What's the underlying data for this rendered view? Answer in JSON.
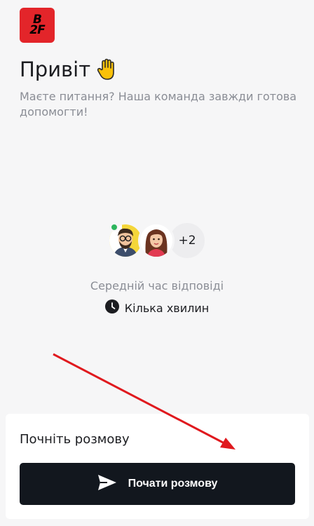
{
  "brand": {
    "logo_line1": "B",
    "logo_line2": "2F",
    "accent": "#e3252a"
  },
  "header": {
    "greeting": "Привіт",
    "greeting_icon": "raised-hand-icon",
    "subtitle": "Маєте питання? Наша команда завжди готова допомогти!"
  },
  "team": {
    "online_status_color": "#2db55d",
    "extra_count": "+2"
  },
  "response": {
    "label": "Середній час відповіді",
    "value": "Кілька хвилин",
    "icon": "clock-icon"
  },
  "conversation": {
    "title": "Почніть розмову",
    "button_label": "Почати розмову",
    "button_icon": "send-icon",
    "button_color": "#12171e"
  },
  "annotation": {
    "arrow_color": "#e0191e"
  }
}
